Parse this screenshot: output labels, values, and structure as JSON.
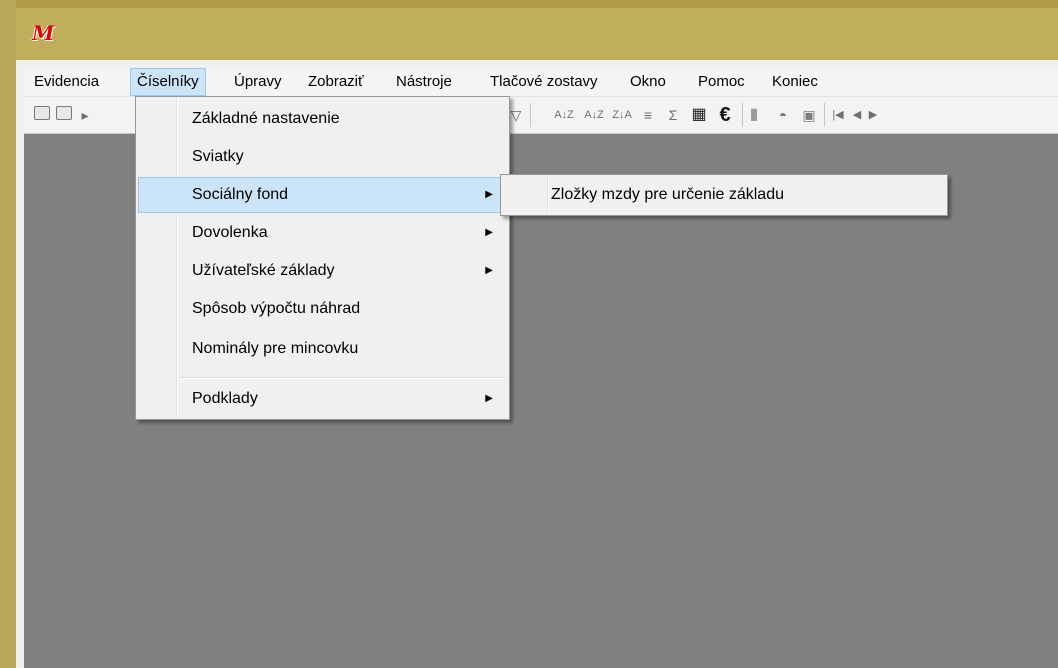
{
  "menubar": {
    "items": [
      {
        "label": "Evidencia"
      },
      {
        "label": "Číselníky"
      },
      {
        "label": "Úpravy"
      },
      {
        "label": "Zobraziť"
      },
      {
        "label": "Nástroje"
      },
      {
        "label": "Tlačové zostavy"
      },
      {
        "label": "Okno"
      },
      {
        "label": "Pomoc"
      },
      {
        "label": "Koniec"
      }
    ]
  },
  "toolbar": {
    "sort_az": "A↓Z",
    "sort_za": "Z↓A",
    "sigma": "Σ",
    "euro": "€"
  },
  "dropdown": {
    "items": [
      {
        "label": "Základné nastavenie"
      },
      {
        "label": "Sviatky"
      },
      {
        "label": "Sociálny fond"
      },
      {
        "label": "Dovolenka"
      },
      {
        "label": "Užívateľské základy"
      },
      {
        "label": "Spôsob výpočtu náhrad"
      },
      {
        "label": "Nominály pre mincovku"
      },
      {
        "label": "Podklady"
      }
    ]
  },
  "submenu": {
    "items": [
      {
        "label": "Zložky mzdy pre určenie základu"
      }
    ]
  },
  "colors": {
    "title_bar": "#c0ae5c",
    "workspace": "#808080",
    "highlight": "#cce4f7",
    "logo": "#e00000"
  }
}
